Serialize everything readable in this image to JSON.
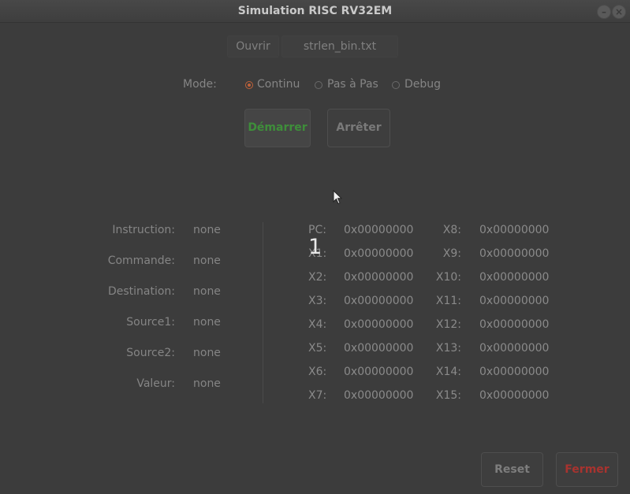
{
  "window": {
    "title": "Simulation RISC RV32EM"
  },
  "file": {
    "open_label": "Ouvrir",
    "filename": "strlen_bin.txt"
  },
  "mode": {
    "label": "Mode:",
    "options": [
      {
        "label": "Continu",
        "selected": true
      },
      {
        "label": "Pas à Pas",
        "selected": false
      },
      {
        "label": "Debug",
        "selected": false
      }
    ]
  },
  "controls": {
    "start_label": "Démarrer",
    "stop_label": "Arrêter",
    "start_color": "#3e8e3a"
  },
  "instruction_panel": {
    "rows": [
      {
        "label": "Instruction:",
        "value": "none"
      },
      {
        "label": "Commande:",
        "value": "none"
      },
      {
        "label": "Destination:",
        "value": "none"
      },
      {
        "label": "Source1:",
        "value": "none"
      },
      {
        "label": "Source2:",
        "value": "none"
      },
      {
        "label": "Valeur:",
        "value": "none"
      }
    ]
  },
  "registers": {
    "left": [
      {
        "name": "PC:",
        "value": "0x00000000"
      },
      {
        "name": "X1:",
        "value": "0x00000000"
      },
      {
        "name": "X2:",
        "value": "0x00000000"
      },
      {
        "name": "X3:",
        "value": "0x00000000"
      },
      {
        "name": "X4:",
        "value": "0x00000000"
      },
      {
        "name": "X5:",
        "value": "0x00000000"
      },
      {
        "name": "X6:",
        "value": "0x00000000"
      },
      {
        "name": "X7:",
        "value": "0x00000000"
      }
    ],
    "right": [
      {
        "name": "X8:",
        "value": "0x00000000"
      },
      {
        "name": "X9:",
        "value": "0x00000000"
      },
      {
        "name": "X10:",
        "value": "0x00000000"
      },
      {
        "name": "X11:",
        "value": "0x00000000"
      },
      {
        "name": "X12:",
        "value": "0x00000000"
      },
      {
        "name": "X13:",
        "value": "0x00000000"
      },
      {
        "name": "X14:",
        "value": "0x00000000"
      },
      {
        "name": "X15:",
        "value": "0x00000000"
      }
    ]
  },
  "overlay": {
    "number": "1"
  },
  "footer": {
    "reset_label": "Reset",
    "close_label": "Fermer",
    "close_color": "#a8332f"
  }
}
